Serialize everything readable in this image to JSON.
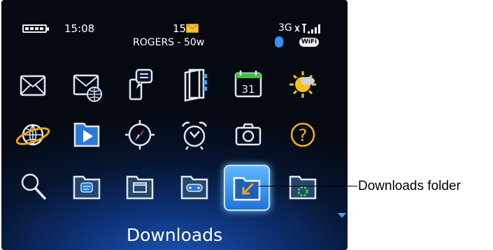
{
  "status_bar": {
    "time": "15:08",
    "message_count": "15",
    "carrier": "ROGERS - 50w",
    "network": "3G",
    "wifi_badge": "WiFi"
  },
  "apps": [
    {
      "name": "messages",
      "icon": "envelope-icon"
    },
    {
      "name": "email",
      "icon": "email-globe-icon"
    },
    {
      "name": "text-messages",
      "icon": "text-messages-icon"
    },
    {
      "name": "contacts",
      "icon": "contacts-book-icon"
    },
    {
      "name": "calendar",
      "icon": "calendar-icon",
      "badge": "31"
    },
    {
      "name": "weather",
      "icon": "weather-sun-icon"
    },
    {
      "name": "browser",
      "icon": "browser-globe-icon"
    },
    {
      "name": "media",
      "icon": "media-play-icon"
    },
    {
      "name": "maps",
      "icon": "compass-icon"
    },
    {
      "name": "clock",
      "icon": "alarm-clock-icon"
    },
    {
      "name": "camera",
      "icon": "camera-icon"
    },
    {
      "name": "help",
      "icon": "help-icon",
      "glyph": "?"
    },
    {
      "name": "search",
      "icon": "search-icon"
    },
    {
      "name": "instant-messaging-folder",
      "icon": "folder-chat-icon"
    },
    {
      "name": "applications-folder",
      "icon": "folder-window-icon"
    },
    {
      "name": "games-folder",
      "icon": "folder-games-icon"
    },
    {
      "name": "downloads-folder",
      "icon": "folder-download-icon",
      "selected": true
    },
    {
      "name": "settings-folder",
      "icon": "folder-settings-icon"
    }
  ],
  "focused_label": "Downloads",
  "callout": "Downloads folder",
  "colors": {
    "accent": "#2f8fff",
    "background": "#061530",
    "icon": "#dfe8f2"
  }
}
